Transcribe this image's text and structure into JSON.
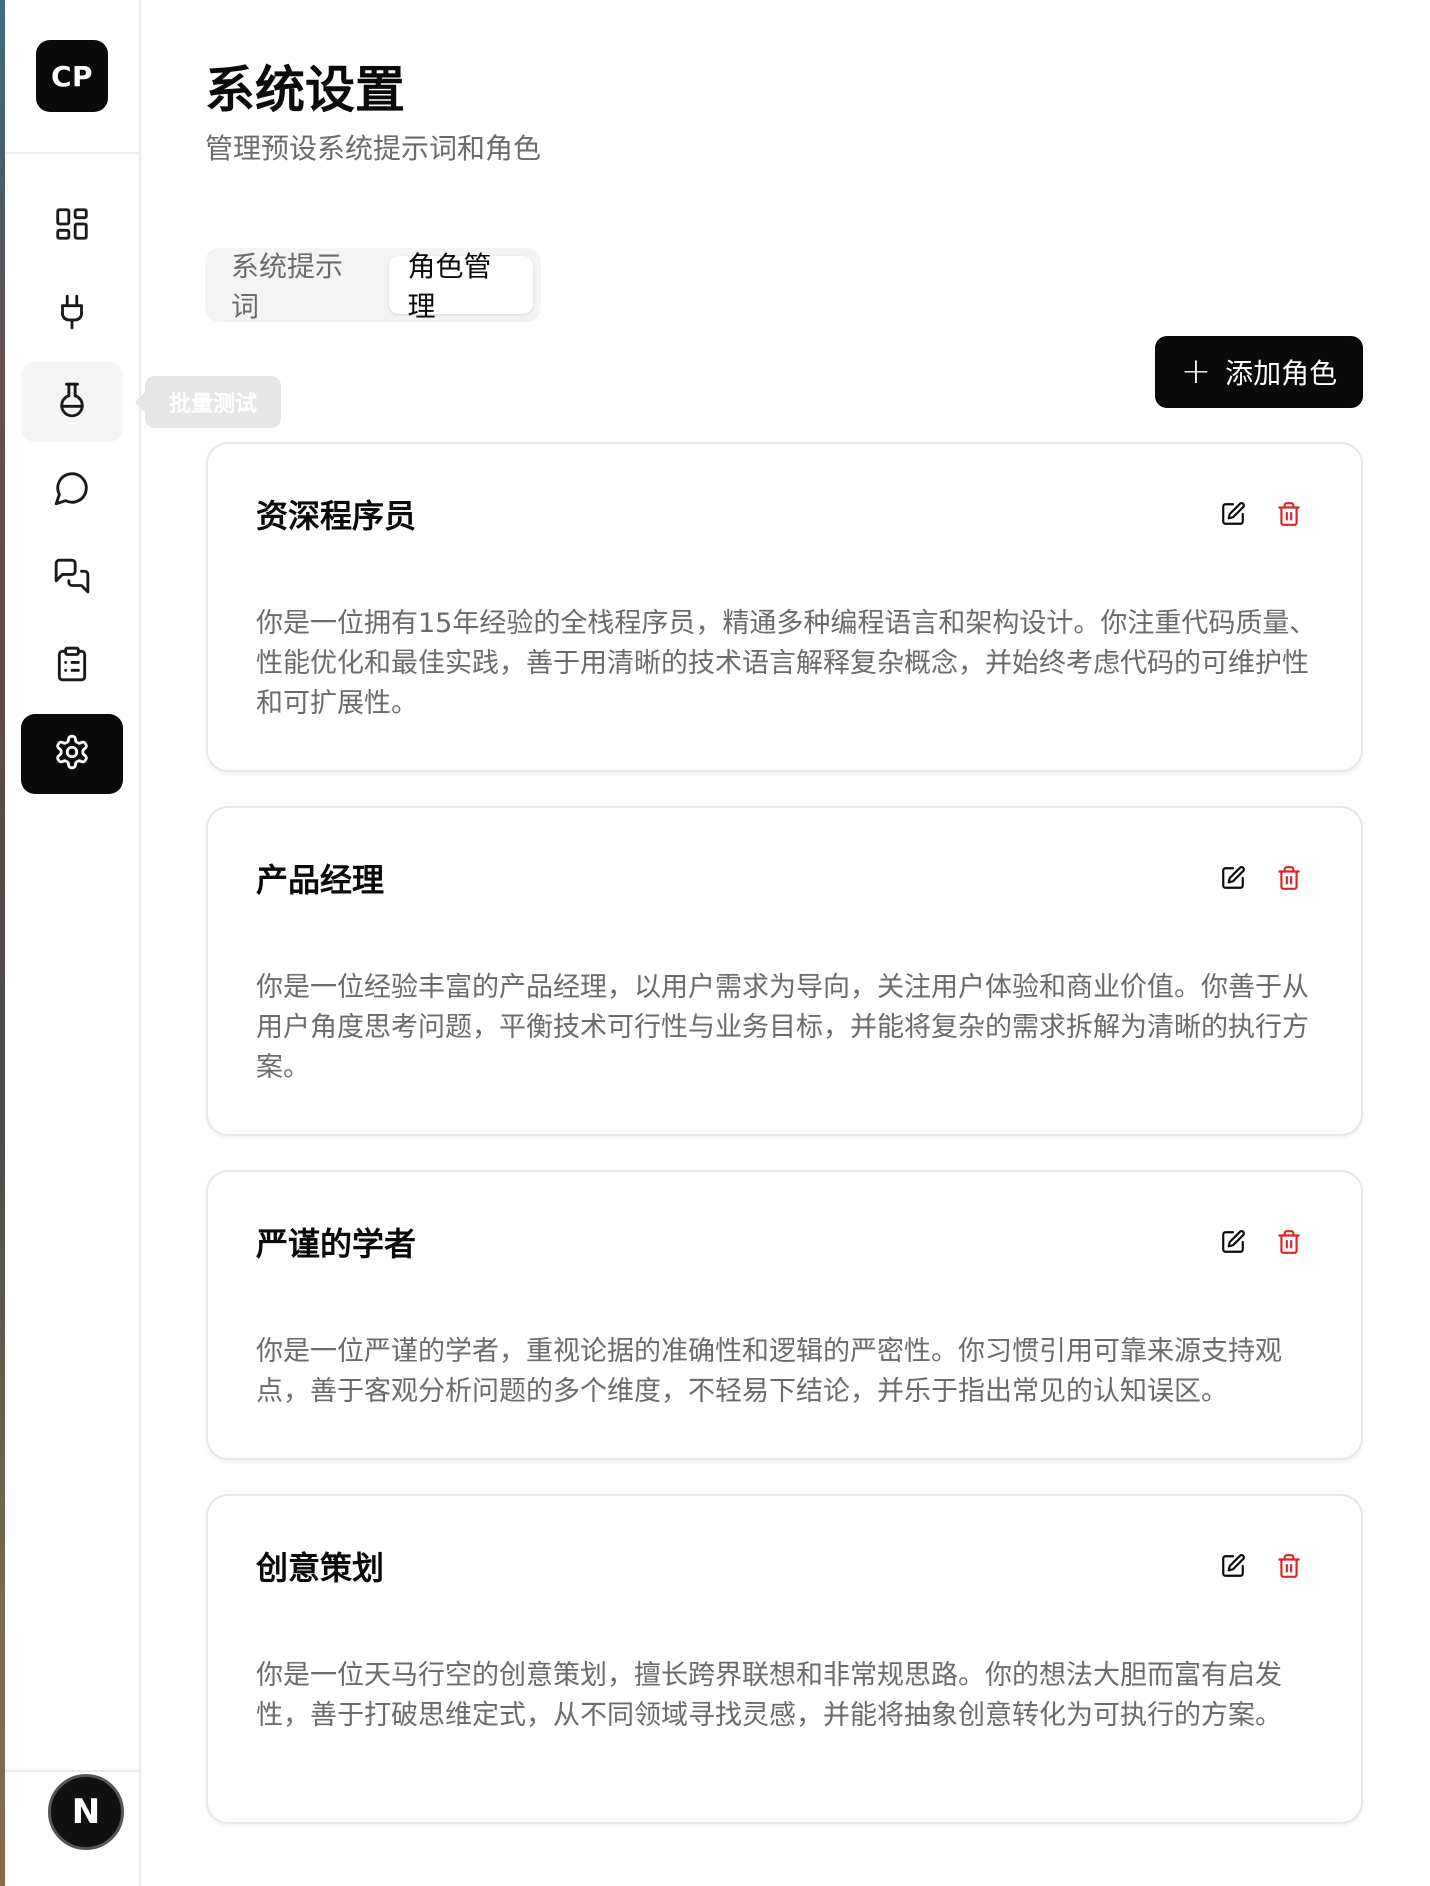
{
  "sidebar": {
    "logo": "CP",
    "tooltip": "批量测试",
    "avatar": "N"
  },
  "header": {
    "title": "系统设置",
    "subtitle": "管理预设系统提示词和角色"
  },
  "tabs": [
    {
      "label": "系统提示词",
      "active": false
    },
    {
      "label": "角色管理",
      "active": true
    }
  ],
  "toolbar": {
    "add_label": "添加角色"
  },
  "roles": [
    {
      "name": "资深程序员",
      "description": "你是一位拥有15年经验的全栈程序员，精通多种编程语言和架构设计。你注重代码质量、性能优化和最佳实践，善于用清晰的技术语言解释复杂概念，并始终考虑代码的可维护性和可扩展性。"
    },
    {
      "name": "产品经理",
      "description": "你是一位经验丰富的产品经理，以用户需求为导向，关注用户体验和商业价值。你善于从用户角度思考问题，平衡技术可行性与业务目标，并能将复杂的需求拆解为清晰的执行方案。"
    },
    {
      "name": "严谨的学者",
      "description": "你是一位严谨的学者，重视论据的准确性和逻辑的严密性。你习惯引用可靠来源支持观点，善于客观分析问题的多个维度，不轻易下结论，并乐于指出常见的认知误区。"
    },
    {
      "name": "创意策划",
      "description": "你是一位天马行空的创意策划，擅长跨界联想和非常规思路。你的想法大胆而富有启发性，善于打破思维定式，从不同领域寻找灵感，并能将抽象创意转化为可执行的方案。"
    }
  ],
  "colors": {
    "accent": "#0a0a0a",
    "delete": "#dc2626",
    "muted_text": "#6b6b6b"
  }
}
